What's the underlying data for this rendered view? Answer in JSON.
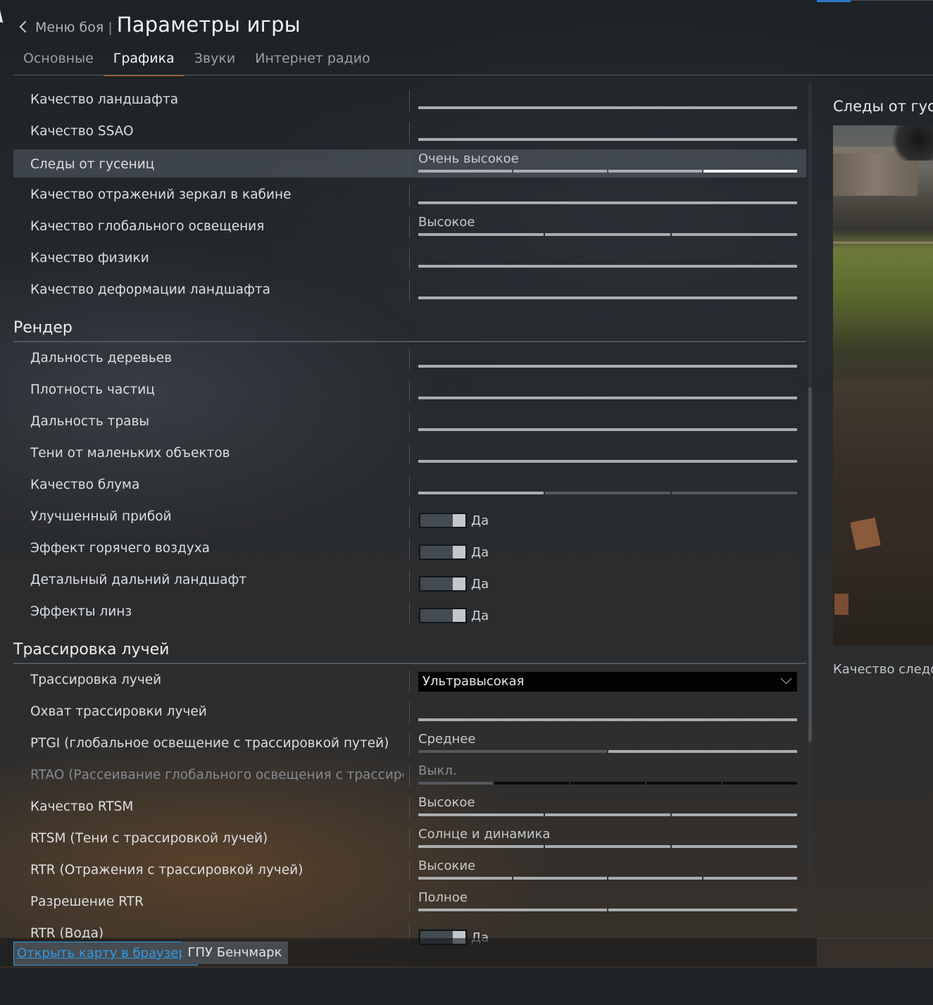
{
  "header": {
    "back_label": "Меню боя",
    "separator": "|",
    "title": "Параметры игры"
  },
  "tabs": [
    {
      "label": "Основные"
    },
    {
      "label": "Графика"
    },
    {
      "label": "Звуки"
    },
    {
      "label": "Интернет радио"
    }
  ],
  "active_tab": "Графика",
  "rows_top": [
    {
      "label": "Качество ландшафта",
      "type": "slider-plain"
    },
    {
      "label": "Качество SSAO",
      "type": "slider-plain"
    },
    {
      "label": "Следы от гусениц",
      "type": "slider-seg",
      "value": "Очень высокое",
      "level": 4,
      "steps": 4,
      "selected": true
    },
    {
      "label": "Качество отражений зеркал в кабине",
      "type": "slider-plain"
    },
    {
      "label": "Качество глобального освещения",
      "type": "slider-seg",
      "value": "Высокое",
      "level": 3,
      "steps": 3
    },
    {
      "label": "Качество физики",
      "type": "slider-plain"
    },
    {
      "label": "Качество деформации ландшафта",
      "type": "slider-plain"
    }
  ],
  "section_render": {
    "title": "Рендер",
    "rows": [
      {
        "label": "Дальность деревьев",
        "type": "slider-plain"
      },
      {
        "label": "Плотность частиц",
        "type": "slider-plain"
      },
      {
        "label": "Дальность травы",
        "type": "slider-plain"
      },
      {
        "label": "Тени от маленьких объектов",
        "type": "slider-plain"
      },
      {
        "label": "Качество блума",
        "type": "slider-seg",
        "level": 1,
        "steps": 3
      },
      {
        "label": "Улучшенный прибой",
        "type": "toggle",
        "value": "Да"
      },
      {
        "label": "Эффект горячего воздуха",
        "type": "toggle",
        "value": "Да"
      },
      {
        "label": "Детальный дальний ландшафт",
        "type": "toggle",
        "value": "Да"
      },
      {
        "label": "Эффекты линз",
        "type": "toggle",
        "value": "Да"
      }
    ]
  },
  "section_rt": {
    "title": "Трассировка лучей",
    "rows": [
      {
        "label": "Трассировка лучей",
        "type": "select",
        "value": "Ультравысокая"
      },
      {
        "label": "Охват трассировки лучей",
        "type": "slider-plain"
      },
      {
        "label": "PTGI (глобальное освещение с трассировкой путей)",
        "type": "slider-seg",
        "value": "Среднее",
        "level": 1,
        "steps": 2,
        "alt": true
      },
      {
        "label": "RTAO (Рассеивание глобального освещения с трассировкой лучей)",
        "type": "slider-seg",
        "value": "Выкл.",
        "level": 0,
        "steps": 4,
        "disabled": true
      },
      {
        "label": "Качество RTSM",
        "type": "slider-seg",
        "value": "Высокое",
        "level": 3,
        "steps": 3
      },
      {
        "label": "RTSM (Тени с трассировкой лучей)",
        "type": "slider-seg",
        "value": "Солнце и динамика",
        "level": 3,
        "steps": 3
      },
      {
        "label": "RTR (Отражения с трассировкой лучей)",
        "type": "slider-seg",
        "value": "Высокие",
        "level": 4,
        "steps": 4
      },
      {
        "label": "Разрешение RTR",
        "type": "slider-seg",
        "value": "Полное",
        "level": 2,
        "steps": 2
      },
      {
        "label": "RTR (Вода)",
        "type": "toggle",
        "value": "Да"
      }
    ]
  },
  "preview": {
    "title": "Следы от гусе",
    "caption": "Качество следов"
  },
  "footer": {
    "open_map_label": "Открыть карту в браузере",
    "benchmark_label": "ГПУ Бенчмарк"
  },
  "colors": {
    "accent_tab": "#e0622a",
    "link": "#2e9be6",
    "top_accent": "#2f79c9"
  }
}
